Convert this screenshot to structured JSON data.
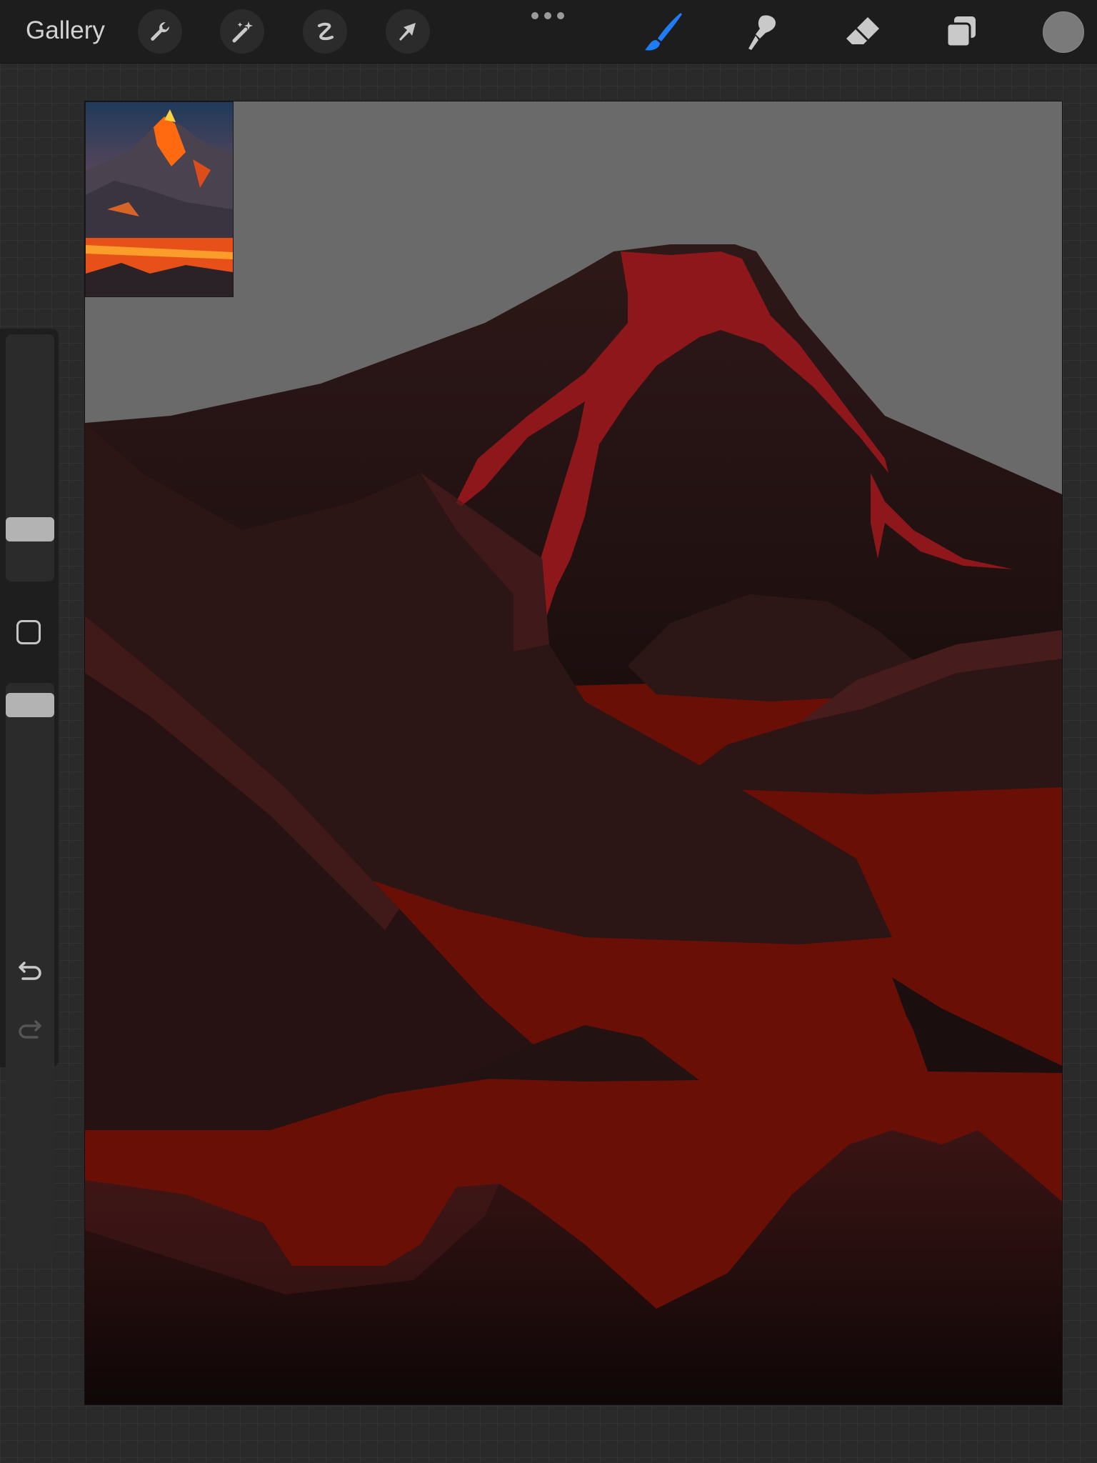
{
  "topbar": {
    "gallery_label": "Gallery",
    "left_tools": [
      "wrench-icon",
      "magic-wand-icon",
      "selection-s-icon",
      "transform-arrow-icon"
    ],
    "right_tools": [
      "brush-icon",
      "smudge-icon",
      "eraser-icon",
      "layers-icon"
    ],
    "active_tool": "brush",
    "active_color": "#1f7cf5",
    "current_color": "#7a7a7a"
  },
  "sidebar": {
    "brush_size_level": 0.36,
    "brush_opacity_level": 0.76,
    "modifier_icon": "square-icon",
    "undo_icon": "undo-icon",
    "redo_icon": "redo-icon"
  },
  "canvas": {
    "sky_color": "#6a6a6a",
    "lava_color": "#6a0f06",
    "lava_flow_color": "#8d171a",
    "rock_color": "#2a1616"
  },
  "reference_image": {
    "subject": "volcano-reference-thumbnail"
  }
}
